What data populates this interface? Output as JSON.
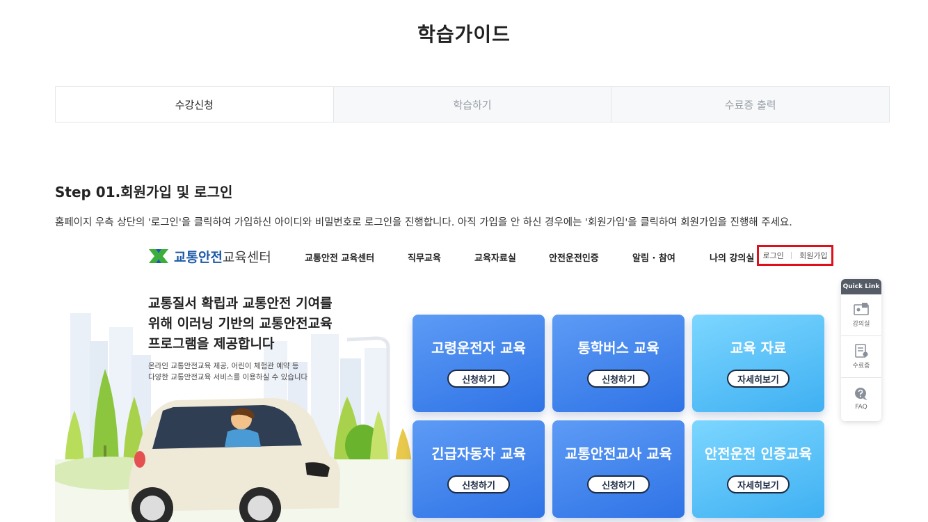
{
  "page": {
    "title": "학습가이드"
  },
  "tabs": [
    {
      "label": "수강신청",
      "active": true
    },
    {
      "label": "학습하기",
      "active": false
    },
    {
      "label": "수료증 출력",
      "active": false
    }
  ],
  "step": {
    "title": "Step 01.회원가입 및 로그인",
    "description": "홈페이지 우측 상단의 '로그인'을 클릭하여 가입하신 아이디와 비밀번호로 로그인을 진행합니다. 아직 가입을 안 하신 경우에는 '회원가입'을 클릭하여 회원가입을 진행해 주세요."
  },
  "site": {
    "logo_bold": "교통안전",
    "logo_thin": "교육센터",
    "menu": [
      "교통안전 교육센터",
      "직무교육",
      "교육자료실",
      "안전운전인증",
      "알림 · 참여",
      "나의 강의실"
    ],
    "util": {
      "login": "로그인",
      "signup": "회원가입"
    },
    "hero": {
      "line1": "교통질서 확립과 교통안전 기여를",
      "line2": "위해 이러닝 기반의 교통안전교육",
      "line3": "프로그램을 제공합니다",
      "sub1": "온라인 교통안전교육 제공, 어린이 체험관 예약 등",
      "sub2": "다양한 교통안전교육 서비스를 이용하실 수 있습니다"
    },
    "cards": [
      {
        "title": "고령운전자 교육",
        "button": "신청하기"
      },
      {
        "title": "통학버스 교육",
        "button": "신청하기"
      },
      {
        "title": "교육 자료",
        "button": "자세히보기"
      },
      {
        "title": "긴급자동차 교육",
        "button": "신청하기"
      },
      {
        "title": "교통안전교사 교육",
        "button": "신청하기"
      },
      {
        "title": "안전운전 인증교육",
        "button": "자세히보기"
      }
    ],
    "quick_link": {
      "title": "Quick Link",
      "items": [
        {
          "label": "강의실",
          "icon": "classroom-icon"
        },
        {
          "label": "수료증",
          "icon": "certificate-icon"
        },
        {
          "label": "FAQ",
          "icon": "faq-icon"
        }
      ]
    }
  },
  "colors": {
    "highlight": "#e0101a",
    "card_blue": "#2f73e6",
    "card_light": "#3fb0f2",
    "logo_green": "#3cae3c",
    "logo_blue": "#1c5aa6"
  }
}
